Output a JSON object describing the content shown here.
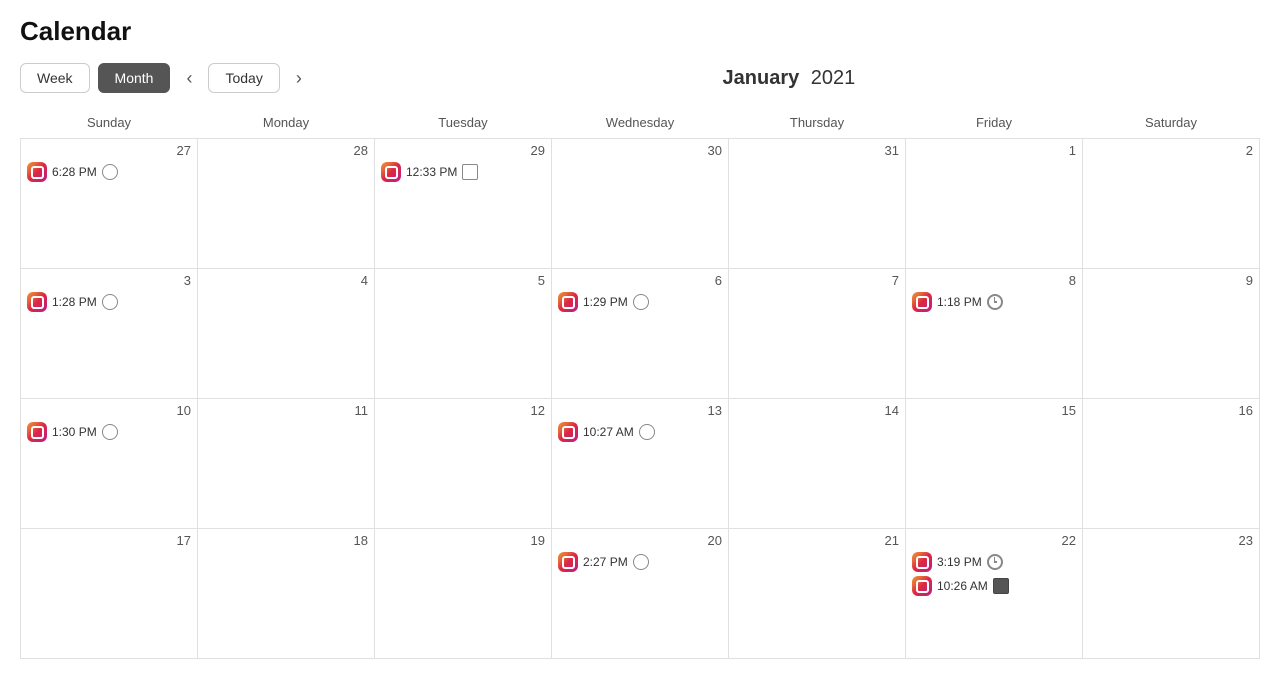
{
  "page": {
    "title": "Calendar"
  },
  "toolbar": {
    "week_label": "Week",
    "month_label": "Month",
    "today_label": "Today",
    "month_title": "January",
    "year": "2021"
  },
  "day_headers": [
    "Sunday",
    "Monday",
    "Tuesday",
    "Wednesday",
    "Thursday",
    "Friday",
    "Saturday"
  ],
  "weeks": [
    {
      "days": [
        {
          "date": "27",
          "events": [
            {
              "time": "6:28 PM",
              "icon": "instagram",
              "tag": "globe"
            }
          ]
        },
        {
          "date": "28",
          "events": []
        },
        {
          "date": "29",
          "events": [
            {
              "time": "12:33 PM",
              "icon": "instagram",
              "tag": "image"
            }
          ]
        },
        {
          "date": "30",
          "events": []
        },
        {
          "date": "31",
          "events": []
        },
        {
          "date": "1",
          "events": []
        },
        {
          "date": "2",
          "events": []
        }
      ]
    },
    {
      "days": [
        {
          "date": "3",
          "events": [
            {
              "time": "1:28 PM",
              "icon": "instagram",
              "tag": "globe"
            }
          ]
        },
        {
          "date": "4",
          "events": []
        },
        {
          "date": "5",
          "events": []
        },
        {
          "date": "6",
          "events": [
            {
              "time": "1:29 PM",
              "icon": "instagram",
              "tag": "globe"
            }
          ]
        },
        {
          "date": "7",
          "events": []
        },
        {
          "date": "8",
          "events": [
            {
              "time": "1:18 PM",
              "icon": "instagram",
              "tag": "clock"
            }
          ]
        },
        {
          "date": "9",
          "events": []
        }
      ]
    },
    {
      "days": [
        {
          "date": "10",
          "events": [
            {
              "time": "1:30 PM",
              "icon": "instagram",
              "tag": "globe"
            }
          ]
        },
        {
          "date": "11",
          "events": []
        },
        {
          "date": "12",
          "events": []
        },
        {
          "date": "13",
          "events": [
            {
              "time": "10:27 AM",
              "icon": "instagram",
              "tag": "globe"
            }
          ]
        },
        {
          "date": "14",
          "events": []
        },
        {
          "date": "15",
          "events": []
        },
        {
          "date": "16",
          "events": []
        }
      ]
    },
    {
      "days": [
        {
          "date": "17",
          "events": []
        },
        {
          "date": "18",
          "events": []
        },
        {
          "date": "19",
          "events": []
        },
        {
          "date": "20",
          "events": [
            {
              "time": "2:27 PM",
              "icon": "instagram",
              "tag": "globe"
            }
          ]
        },
        {
          "date": "21",
          "events": []
        },
        {
          "date": "22",
          "events": [
            {
              "time": "3:19 PM",
              "icon": "instagram",
              "tag": "clock"
            },
            {
              "time": "10:26 AM",
              "icon": "instagram",
              "tag": "video"
            }
          ]
        },
        {
          "date": "23",
          "events": []
        }
      ]
    }
  ]
}
